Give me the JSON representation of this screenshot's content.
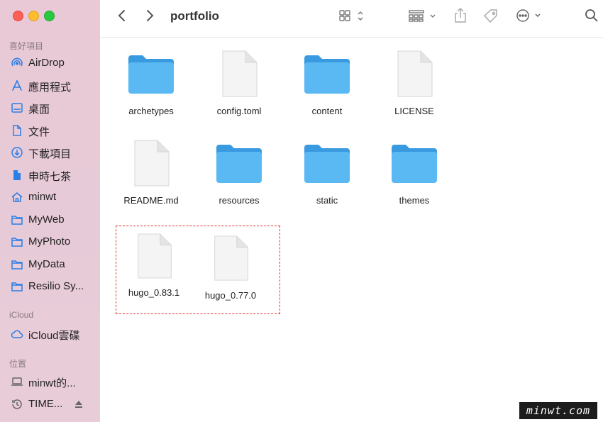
{
  "window": {
    "title": "portfolio"
  },
  "sidebar": {
    "favorites_header": "喜好項目",
    "favorites": [
      {
        "label": "AirDrop",
        "icon": "airdrop-icon"
      },
      {
        "label": "應用程式",
        "icon": "applications-icon"
      },
      {
        "label": "桌面",
        "icon": "desktop-icon"
      },
      {
        "label": "文件",
        "icon": "document-icon"
      },
      {
        "label": "下載項目",
        "icon": "download-icon"
      },
      {
        "label": "申時七茶",
        "icon": "file-icon"
      },
      {
        "label": "minwt",
        "icon": "home-icon"
      },
      {
        "label": "MyWeb",
        "icon": "folder-icon"
      },
      {
        "label": "MyPhoto",
        "icon": "folder-icon"
      },
      {
        "label": "MyData",
        "icon": "folder-icon"
      },
      {
        "label": "Resilio Sy...",
        "icon": "folder-icon"
      }
    ],
    "icloud_header": "iCloud",
    "icloud": [
      {
        "label": "iCloud雲碟",
        "icon": "cloud-icon"
      }
    ],
    "locations_header": "位置",
    "locations": [
      {
        "label": "minwt的...",
        "icon": "laptop-icon"
      },
      {
        "label": "TIME...",
        "icon": "time-machine-icon"
      }
    ]
  },
  "files": [
    {
      "name": "archetypes",
      "kind": "folder"
    },
    {
      "name": "config.toml",
      "kind": "document"
    },
    {
      "name": "content",
      "kind": "folder"
    },
    {
      "name": "LICENSE",
      "kind": "document"
    },
    {
      "name": "README.md",
      "kind": "document"
    },
    {
      "name": "resources",
      "kind": "folder"
    },
    {
      "name": "static",
      "kind": "folder"
    },
    {
      "name": "themes",
      "kind": "folder"
    },
    {
      "name": "hugo_0.83.1",
      "kind": "document"
    },
    {
      "name": "hugo_0.77.0",
      "kind": "document"
    }
  ],
  "watermark": "minwt.com",
  "colors": {
    "folder": "#5ab8f2",
    "folder_tab": "#3a9ae0",
    "highlight_border": "#d9342b",
    "sidebar_icon": "#2a7ee6"
  }
}
